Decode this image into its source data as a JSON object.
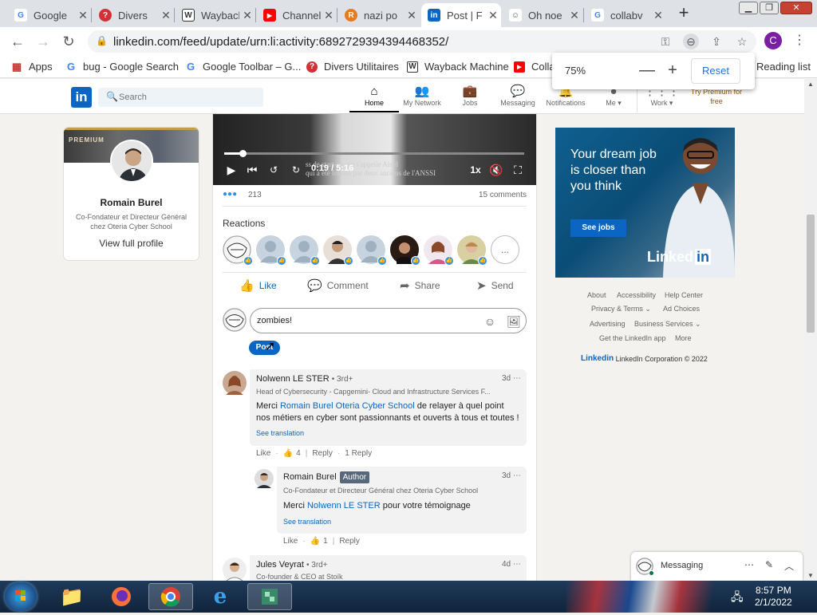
{
  "browser": {
    "tabs": [
      {
        "title": "Google",
        "fav": "G",
        "favcolor": "#4285f4"
      },
      {
        "title": "Divers",
        "fav": "?",
        "favcolor": "#d23237"
      },
      {
        "title": "Wayback",
        "fav": "W",
        "favcolor": "#333333"
      },
      {
        "title": "Channel",
        "fav": "▶",
        "favcolor": "#ff0000"
      },
      {
        "title": "nazi po",
        "fav": "R",
        "favcolor": "#e87a1e"
      },
      {
        "title": "Post | F",
        "fav": "in",
        "favcolor": "#0a66c2"
      },
      {
        "title": "Oh noe",
        "fav": "☺",
        "favcolor": "#555555"
      },
      {
        "title": "collabv",
        "fav": "G",
        "favcolor": "#4285f4"
      }
    ],
    "url": "linkedin.com/feed/update/urn:li:activity:6892729394394468352/",
    "profile_initial": "C",
    "bookmarks": [
      {
        "label": "Apps",
        "ic": "▦",
        "color": "#555555"
      },
      {
        "label": "bug - Google Search",
        "ic": "G",
        "color": "#4285f4"
      },
      {
        "label": "Google Toolbar – G...",
        "ic": "G",
        "color": "#4285f4"
      },
      {
        "label": "Divers Utilitaires",
        "ic": "?",
        "color": "#d23237"
      },
      {
        "label": "Wayback Machine",
        "ic": "W",
        "color": "#333333"
      },
      {
        "label": "Colla",
        "ic": "▶",
        "color": "#ff0000"
      }
    ],
    "reading_list": "Reading list",
    "zoom": {
      "value": "75%",
      "minus": "—",
      "plus": "+",
      "reset": "Reset"
    }
  },
  "linkedin": {
    "search_placeholder": "Search",
    "nav": [
      {
        "label": "Home",
        "icon": "⌂"
      },
      {
        "label": "My Network",
        "icon": "👥"
      },
      {
        "label": "Jobs",
        "icon": "💼"
      },
      {
        "label": "Messaging",
        "icon": "💬"
      },
      {
        "label": "Notifications",
        "icon": "🔔"
      },
      {
        "label": "Me",
        "icon": "●"
      },
      {
        "label": "Work",
        "icon": "⋮⋮⋮"
      }
    ],
    "premium": "Try Premium for free",
    "profile": {
      "badge": "PREMIUM",
      "name": "Romain Burel",
      "title": "Co-Fondateur et Directeur Général chez Oteria Cyber School",
      "view": "View full profile"
    },
    "post": {
      "video_time": "0:19 / 5:16",
      "video_speed": "1x",
      "subtitle_line1": "ss de start-up qui s'appelle Alsid",
      "subtitle_line2": "qui a été fondée par deux anciens de l'ANSSI",
      "progress": 0.06,
      "reaction_count": "213",
      "comments_count": "15 comments",
      "reactions_title": "Reactions",
      "more_reactions": "...",
      "actions": {
        "like": "Like",
        "comment": "Comment",
        "share": "Share",
        "send": "Send"
      },
      "comment_input": "zombies!",
      "post_button": "Post"
    },
    "comments": [
      {
        "name": "Nolwenn LE STER",
        "degree": "• 3rd+",
        "headline": "Head of Cybersecurity - Capgemini- Cloud and Infrastructure Services F...",
        "time": "3d",
        "text_pre": "Merci ",
        "text_link": "Romain Burel Oteria Cyber School",
        "text_post": " de relayer à quel point nos métiers en cyber sont passionnants et ouverts à tous et toutes !",
        "translate": "See translation",
        "like": "Like",
        "likes": "4",
        "reply": "Reply",
        "replies": "1 Reply"
      },
      {
        "name": "Romain Burel",
        "badge": "Author",
        "headline": "Co-Fondateur et Directeur Général chez Oteria Cyber School",
        "time": "3d",
        "text_pre": "Merci ",
        "text_link": "Nolwenn LE STER",
        "text_post": " pour votre témoignage",
        "translate": "See translation",
        "like": "Like",
        "likes": "1",
        "reply": "Reply"
      },
      {
        "name": "Jules Veyrat",
        "degree": "• 3rd+",
        "headline": "Co-founder & CEO at Stoïk",
        "time": "4d"
      }
    ],
    "ad": {
      "text": "Your dream job is closer than you think",
      "button": "See jobs",
      "logo": "Linked",
      "logo_in": "in"
    },
    "footer": [
      "About",
      "Accessibility",
      "Help Center",
      "Privacy & Terms ⌄",
      "Ad Choices",
      "Advertising",
      "Business Services ⌄",
      "Get the LinkedIn app",
      "More"
    ],
    "copyright_brand": "Linkedin",
    "copyright": "LinkedIn Corporation © 2022",
    "messaging": "Messaging"
  },
  "taskbar": {
    "time": "8:57 PM",
    "date": "2/1/2022"
  }
}
